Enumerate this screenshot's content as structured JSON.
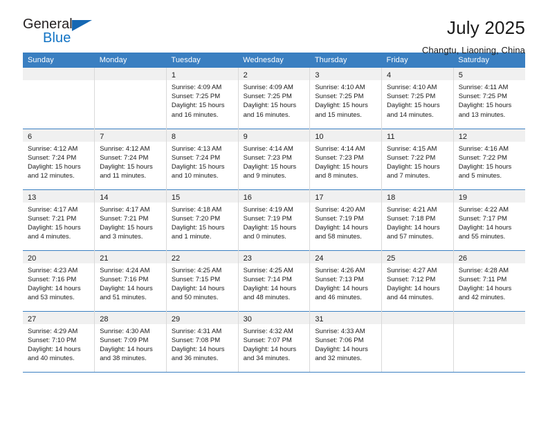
{
  "logo": {
    "primary_text": "General",
    "secondary_text": "Blue",
    "triangle_icon": "logo-triangle-icon",
    "brand_blue": "#1273c4"
  },
  "header": {
    "title": "July 2025",
    "subtitle": "Changtu, Liaoning, China"
  },
  "calendar": {
    "header_bg": "#3a7fc1",
    "daynum_bg": "#f0f0f0",
    "weekday_headers": [
      "Sunday",
      "Monday",
      "Tuesday",
      "Wednesday",
      "Thursday",
      "Friday",
      "Saturday"
    ],
    "weeks": [
      [
        {
          "day": "",
          "lines": []
        },
        {
          "day": "",
          "lines": []
        },
        {
          "day": "1",
          "lines": [
            "Sunrise: 4:09 AM",
            "Sunset: 7:25 PM",
            "Daylight: 15 hours",
            "and 16 minutes."
          ]
        },
        {
          "day": "2",
          "lines": [
            "Sunrise: 4:09 AM",
            "Sunset: 7:25 PM",
            "Daylight: 15 hours",
            "and 16 minutes."
          ]
        },
        {
          "day": "3",
          "lines": [
            "Sunrise: 4:10 AM",
            "Sunset: 7:25 PM",
            "Daylight: 15 hours",
            "and 15 minutes."
          ]
        },
        {
          "day": "4",
          "lines": [
            "Sunrise: 4:10 AM",
            "Sunset: 7:25 PM",
            "Daylight: 15 hours",
            "and 14 minutes."
          ]
        },
        {
          "day": "5",
          "lines": [
            "Sunrise: 4:11 AM",
            "Sunset: 7:25 PM",
            "Daylight: 15 hours",
            "and 13 minutes."
          ]
        }
      ],
      [
        {
          "day": "6",
          "lines": [
            "Sunrise: 4:12 AM",
            "Sunset: 7:24 PM",
            "Daylight: 15 hours",
            "and 12 minutes."
          ]
        },
        {
          "day": "7",
          "lines": [
            "Sunrise: 4:12 AM",
            "Sunset: 7:24 PM",
            "Daylight: 15 hours",
            "and 11 minutes."
          ]
        },
        {
          "day": "8",
          "lines": [
            "Sunrise: 4:13 AM",
            "Sunset: 7:24 PM",
            "Daylight: 15 hours",
            "and 10 minutes."
          ]
        },
        {
          "day": "9",
          "lines": [
            "Sunrise: 4:14 AM",
            "Sunset: 7:23 PM",
            "Daylight: 15 hours",
            "and 9 minutes."
          ]
        },
        {
          "day": "10",
          "lines": [
            "Sunrise: 4:14 AM",
            "Sunset: 7:23 PM",
            "Daylight: 15 hours",
            "and 8 minutes."
          ]
        },
        {
          "day": "11",
          "lines": [
            "Sunrise: 4:15 AM",
            "Sunset: 7:22 PM",
            "Daylight: 15 hours",
            "and 7 minutes."
          ]
        },
        {
          "day": "12",
          "lines": [
            "Sunrise: 4:16 AM",
            "Sunset: 7:22 PM",
            "Daylight: 15 hours",
            "and 5 minutes."
          ]
        }
      ],
      [
        {
          "day": "13",
          "lines": [
            "Sunrise: 4:17 AM",
            "Sunset: 7:21 PM",
            "Daylight: 15 hours",
            "and 4 minutes."
          ]
        },
        {
          "day": "14",
          "lines": [
            "Sunrise: 4:17 AM",
            "Sunset: 7:21 PM",
            "Daylight: 15 hours",
            "and 3 minutes."
          ]
        },
        {
          "day": "15",
          "lines": [
            "Sunrise: 4:18 AM",
            "Sunset: 7:20 PM",
            "Daylight: 15 hours",
            "and 1 minute."
          ]
        },
        {
          "day": "16",
          "lines": [
            "Sunrise: 4:19 AM",
            "Sunset: 7:19 PM",
            "Daylight: 15 hours",
            "and 0 minutes."
          ]
        },
        {
          "day": "17",
          "lines": [
            "Sunrise: 4:20 AM",
            "Sunset: 7:19 PM",
            "Daylight: 14 hours",
            "and 58 minutes."
          ]
        },
        {
          "day": "18",
          "lines": [
            "Sunrise: 4:21 AM",
            "Sunset: 7:18 PM",
            "Daylight: 14 hours",
            "and 57 minutes."
          ]
        },
        {
          "day": "19",
          "lines": [
            "Sunrise: 4:22 AM",
            "Sunset: 7:17 PM",
            "Daylight: 14 hours",
            "and 55 minutes."
          ]
        }
      ],
      [
        {
          "day": "20",
          "lines": [
            "Sunrise: 4:23 AM",
            "Sunset: 7:16 PM",
            "Daylight: 14 hours",
            "and 53 minutes."
          ]
        },
        {
          "day": "21",
          "lines": [
            "Sunrise: 4:24 AM",
            "Sunset: 7:16 PM",
            "Daylight: 14 hours",
            "and 51 minutes."
          ]
        },
        {
          "day": "22",
          "lines": [
            "Sunrise: 4:25 AM",
            "Sunset: 7:15 PM",
            "Daylight: 14 hours",
            "and 50 minutes."
          ]
        },
        {
          "day": "23",
          "lines": [
            "Sunrise: 4:25 AM",
            "Sunset: 7:14 PM",
            "Daylight: 14 hours",
            "and 48 minutes."
          ]
        },
        {
          "day": "24",
          "lines": [
            "Sunrise: 4:26 AM",
            "Sunset: 7:13 PM",
            "Daylight: 14 hours",
            "and 46 minutes."
          ]
        },
        {
          "day": "25",
          "lines": [
            "Sunrise: 4:27 AM",
            "Sunset: 7:12 PM",
            "Daylight: 14 hours",
            "and 44 minutes."
          ]
        },
        {
          "day": "26",
          "lines": [
            "Sunrise: 4:28 AM",
            "Sunset: 7:11 PM",
            "Daylight: 14 hours",
            "and 42 minutes."
          ]
        }
      ],
      [
        {
          "day": "27",
          "lines": [
            "Sunrise: 4:29 AM",
            "Sunset: 7:10 PM",
            "Daylight: 14 hours",
            "and 40 minutes."
          ]
        },
        {
          "day": "28",
          "lines": [
            "Sunrise: 4:30 AM",
            "Sunset: 7:09 PM",
            "Daylight: 14 hours",
            "and 38 minutes."
          ]
        },
        {
          "day": "29",
          "lines": [
            "Sunrise: 4:31 AM",
            "Sunset: 7:08 PM",
            "Daylight: 14 hours",
            "and 36 minutes."
          ]
        },
        {
          "day": "30",
          "lines": [
            "Sunrise: 4:32 AM",
            "Sunset: 7:07 PM",
            "Daylight: 14 hours",
            "and 34 minutes."
          ]
        },
        {
          "day": "31",
          "lines": [
            "Sunrise: 4:33 AM",
            "Sunset: 7:06 PM",
            "Daylight: 14 hours",
            "and 32 minutes."
          ]
        },
        {
          "day": "",
          "lines": []
        },
        {
          "day": "",
          "lines": []
        }
      ]
    ]
  }
}
